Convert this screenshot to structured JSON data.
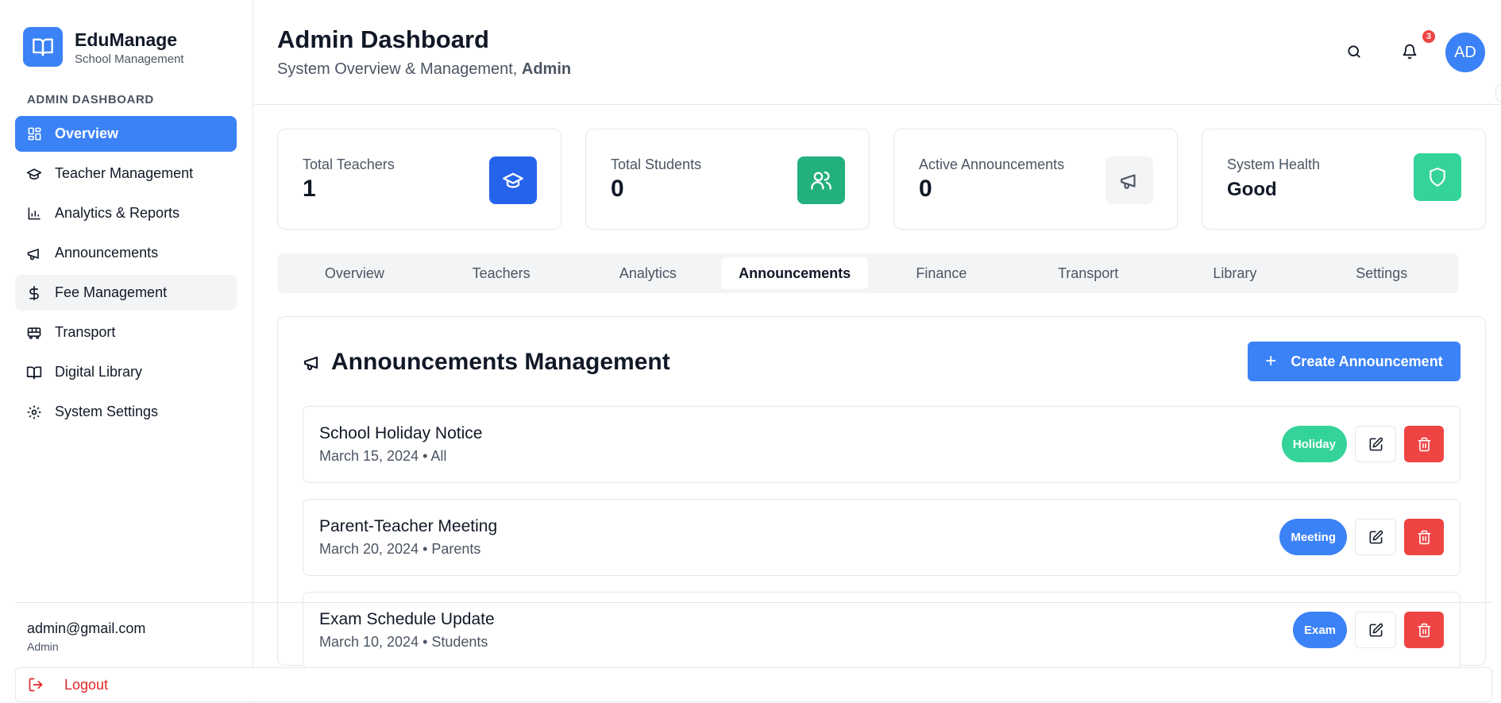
{
  "brand": {
    "title": "EduManage",
    "subtitle": "School Management"
  },
  "sidebar": {
    "section_label": "ADMIN DASHBOARD",
    "items": [
      {
        "label": "Overview",
        "icon": "grid-icon"
      },
      {
        "label": "Teacher Management",
        "icon": "graduation-cap-icon"
      },
      {
        "label": "Analytics & Reports",
        "icon": "bar-chart-icon"
      },
      {
        "label": "Announcements",
        "icon": "megaphone-icon"
      },
      {
        "label": "Fee Management",
        "icon": "dollar-icon"
      },
      {
        "label": "Transport",
        "icon": "bus-icon"
      },
      {
        "label": "Digital Library",
        "icon": "book-open-icon"
      },
      {
        "label": "System Settings",
        "icon": "gear-icon"
      }
    ],
    "user_email": "admin@gmail.com",
    "user_role": "Admin",
    "logout_label": "Logout"
  },
  "header": {
    "title": "Admin Dashboard",
    "subtitle_prefix": "System Overview & Management, ",
    "subtitle_name": "Admin",
    "notification_count": "3",
    "avatar_initials": "AD"
  },
  "stats": [
    {
      "label": "Total Teachers",
      "value": "1",
      "icon": "graduation-cap-icon",
      "color": "#2563eb"
    },
    {
      "label": "Total Students",
      "value": "0",
      "icon": "users-icon",
      "color": "#22b07d"
    },
    {
      "label": "Active Announcements",
      "value": "0",
      "icon": "megaphone-icon",
      "color": "#f3f4f6"
    },
    {
      "label": "System Health",
      "value": "Good",
      "icon": "shield-icon",
      "color": "#34d399"
    }
  ],
  "tabs": [
    "Overview",
    "Teachers",
    "Analytics",
    "Announcements",
    "Finance",
    "Transport",
    "Library",
    "Settings"
  ],
  "active_tab": "Announcements",
  "announcements_panel": {
    "title": "Announcements Management",
    "create_label": "Create Announcement",
    "items": [
      {
        "title": "School Holiday Notice",
        "meta": "March 15, 2024 • All",
        "tag": "Holiday",
        "tag_color": "#34d399"
      },
      {
        "title": "Parent-Teacher Meeting",
        "meta": "March 20, 2024 • Parents",
        "tag": "Meeting",
        "tag_color": "#3b82f6"
      },
      {
        "title": "Exam Schedule Update",
        "meta": "March 10, 2024 • Students",
        "tag": "Exam",
        "tag_color": "#3b82f6"
      }
    ]
  },
  "colors": {
    "accent": "#3b82f6",
    "danger": "#ef4444",
    "muted": "#4b5563",
    "border": "#e5e7eb"
  }
}
